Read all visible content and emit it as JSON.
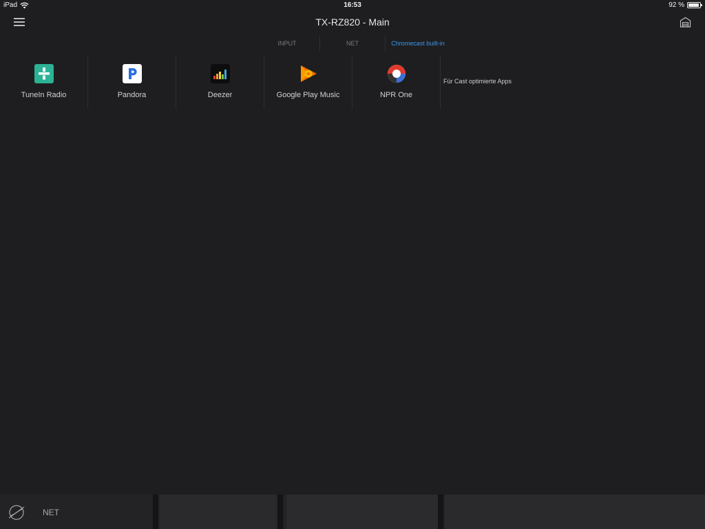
{
  "status": {
    "device": "iPad",
    "time": "16:53",
    "battery": "92 %",
    "battery_level": 0.92
  },
  "header": {
    "title": "TX-RZ820 - Main"
  },
  "tabs": [
    {
      "label": "INPUT",
      "active": false
    },
    {
      "label": "NET",
      "active": false
    },
    {
      "label": "Chromecast built-in",
      "active": true
    }
  ],
  "apps": [
    {
      "label": "TuneIn Radio",
      "icon": "tunein-icon"
    },
    {
      "label": "Pandora",
      "icon": "pandora-icon"
    },
    {
      "label": "Deezer",
      "icon": "deezer-icon"
    },
    {
      "label": "Google Play Music",
      "icon": "google-play-music-icon"
    },
    {
      "label": "NPR One",
      "icon": "npr-one-icon"
    }
  ],
  "cast_apps_label": "Für Cast optimierte Apps",
  "player": {
    "source_label": "NET",
    "source_icon": "globe-icon"
  },
  "colors": {
    "accent": "#3d97e8",
    "background": "#1e1e20",
    "tunein": "#2cb395",
    "deezer_bg": "#0d0d0d"
  }
}
